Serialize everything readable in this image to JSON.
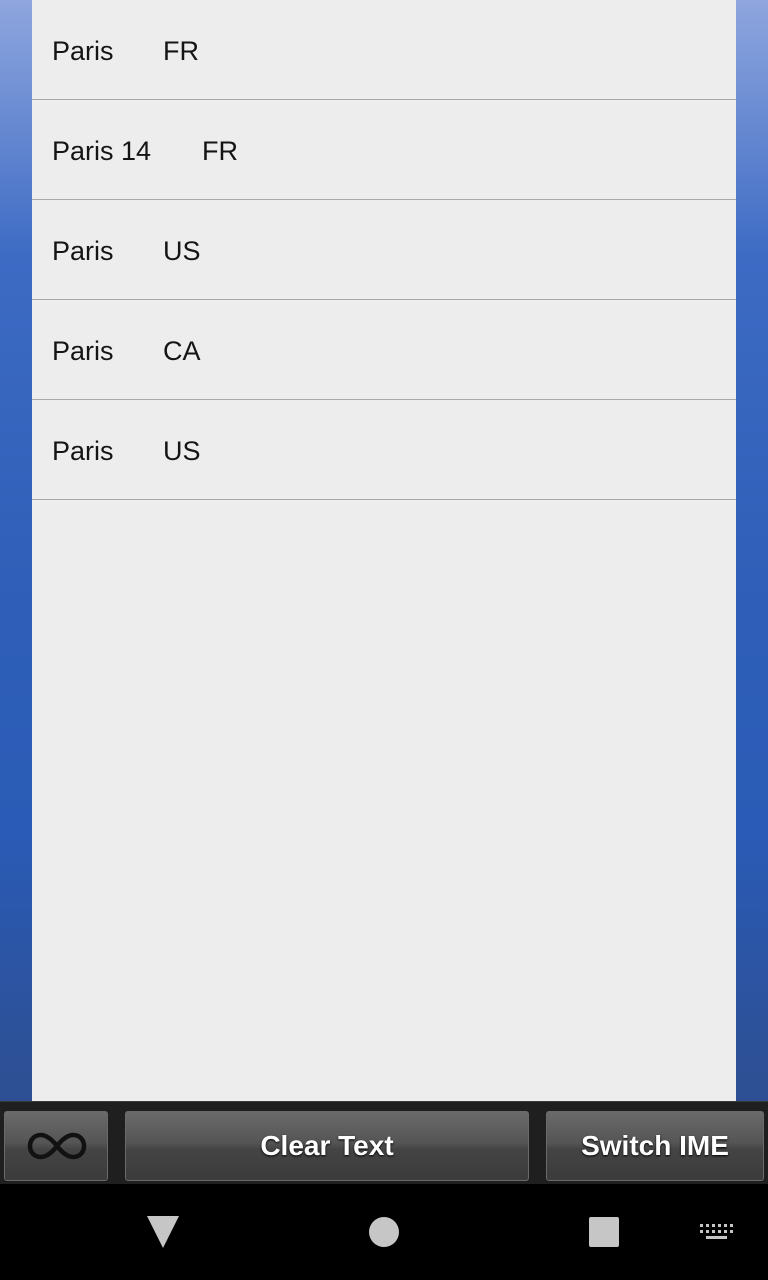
{
  "list": {
    "rows": [
      {
        "name": "Paris",
        "country": "FR"
      },
      {
        "name": "Paris 14",
        "country": "FR"
      },
      {
        "name": "Paris",
        "country": "US"
      },
      {
        "name": "Paris",
        "country": "CA"
      },
      {
        "name": "Paris",
        "country": "US"
      }
    ]
  },
  "toolbar": {
    "infinity_icon": "infinity-icon",
    "clear_label": "Clear Text",
    "switch_label": "Switch IME"
  },
  "navbar": {
    "back_icon": "back-triangle-icon",
    "home_icon": "home-circle-icon",
    "recents_icon": "recents-square-icon",
    "keyboard_icon": "keyboard-icon"
  }
}
